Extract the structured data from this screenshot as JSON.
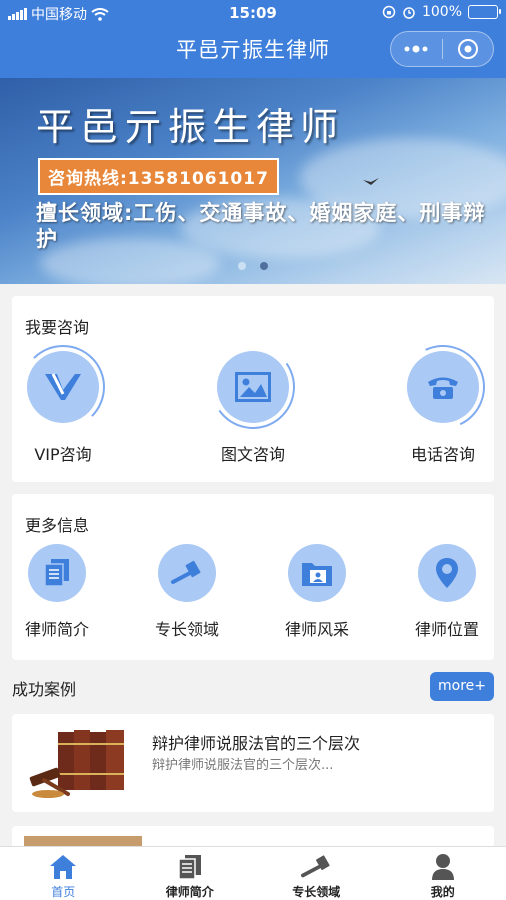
{
  "status_bar": {
    "carrier": "中国移动",
    "time": "15:09",
    "battery": "100%"
  },
  "nav": {
    "title": "平邑亓振生律师",
    "menu_icon": "more-dots-icon",
    "close_icon": "target-circle-icon",
    "color": "#3f7fdc"
  },
  "banner": {
    "title": "平邑亓振生律师",
    "hotline": "咨询热线:13581061017",
    "expertise": "擅长领域:工伤、交通事故、婚姻家庭、刑事辩护",
    "slide_count": 2,
    "active_slide": 2
  },
  "consult": {
    "title": "我要咨询",
    "items": [
      {
        "label": "VIP咨询",
        "icon": "vip-icon"
      },
      {
        "label": "图文咨询",
        "icon": "image-icon"
      },
      {
        "label": "电话咨询",
        "icon": "telephone-icon"
      }
    ]
  },
  "more_info": {
    "title": "更多信息",
    "items": [
      {
        "label": "律师简介",
        "icon": "document-icon"
      },
      {
        "label": "专长领域",
        "icon": "gavel-icon"
      },
      {
        "label": "律师风采",
        "icon": "folder-photo-icon"
      },
      {
        "label": "律师位置",
        "icon": "location-pin-icon"
      }
    ]
  },
  "cases": {
    "title": "成功案例",
    "more_label": "more+",
    "items": [
      {
        "title": "辩护律师说服法官的三个层次",
        "desc": "辩护律师说服法官的三个层次..."
      }
    ]
  },
  "tabbar": {
    "items": [
      {
        "label": "首页",
        "icon": "home-icon",
        "active": true
      },
      {
        "label": "律师简介",
        "icon": "document-icon",
        "active": false
      },
      {
        "label": "专长领域",
        "icon": "gavel-icon",
        "active": false
      },
      {
        "label": "我的",
        "icon": "user-icon",
        "active": false
      }
    ],
    "active_color": "#3f7fdc"
  }
}
